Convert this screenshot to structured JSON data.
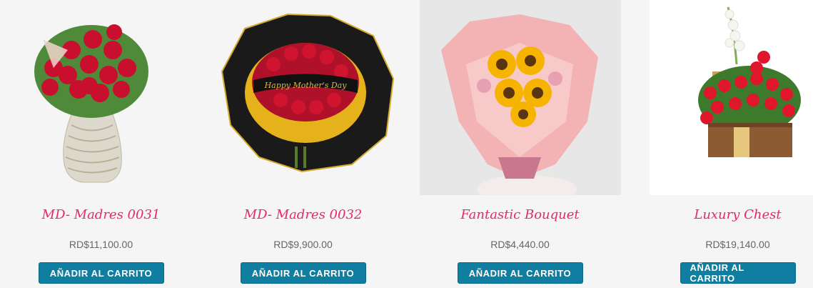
{
  "products": [
    {
      "name": "MD- Madres 0031",
      "price": "RD$11,100.00",
      "button": "AÑADIR AL CARRITO",
      "image_icon": "red-roses-vase-image"
    },
    {
      "name": "MD- Madres 0032",
      "price": "RD$9,900.00",
      "button": "AÑADIR AL CARRITO",
      "image_icon": "roses-sunflowers-black-wrap-image",
      "ribbon_text": "Happy Mother's Day"
    },
    {
      "name": "Fantastic Bouquet",
      "price": "RD$4,440.00",
      "button": "AÑADIR AL CARRITO",
      "image_icon": "sunflower-pink-bouquet-image"
    },
    {
      "name": "Luxury Chest",
      "price": "RD$19,140.00",
      "button": "AÑADIR AL CARRITO",
      "image_icon": "roses-wooden-chest-image"
    }
  ],
  "colors": {
    "title": "#e8266f",
    "button": "#0f7ea1",
    "background": "#f5f5f5"
  }
}
